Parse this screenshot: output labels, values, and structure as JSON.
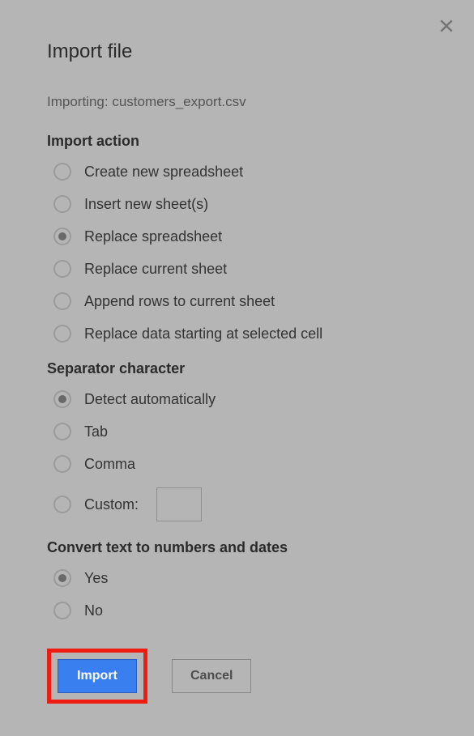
{
  "dialog": {
    "title": "Import file",
    "importing_prefix": "Importing: ",
    "filename": "customers_export.csv"
  },
  "import_action": {
    "heading": "Import action",
    "options": {
      "create_new": "Create new spreadsheet",
      "insert_new": "Insert new sheet(s)",
      "replace_spreadsheet": "Replace spreadsheet",
      "replace_current": "Replace current sheet",
      "append_rows": "Append rows to current sheet",
      "replace_data": "Replace data starting at selected cell"
    },
    "selected": "replace_spreadsheet"
  },
  "separator": {
    "heading": "Separator character",
    "options": {
      "detect": "Detect automatically",
      "tab": "Tab",
      "comma": "Comma",
      "custom": "Custom:"
    },
    "selected": "detect",
    "custom_value": ""
  },
  "convert": {
    "heading": "Convert text to numbers and dates",
    "options": {
      "yes": "Yes",
      "no": "No"
    },
    "selected": "yes"
  },
  "buttons": {
    "import": "Import",
    "cancel": "Cancel"
  }
}
